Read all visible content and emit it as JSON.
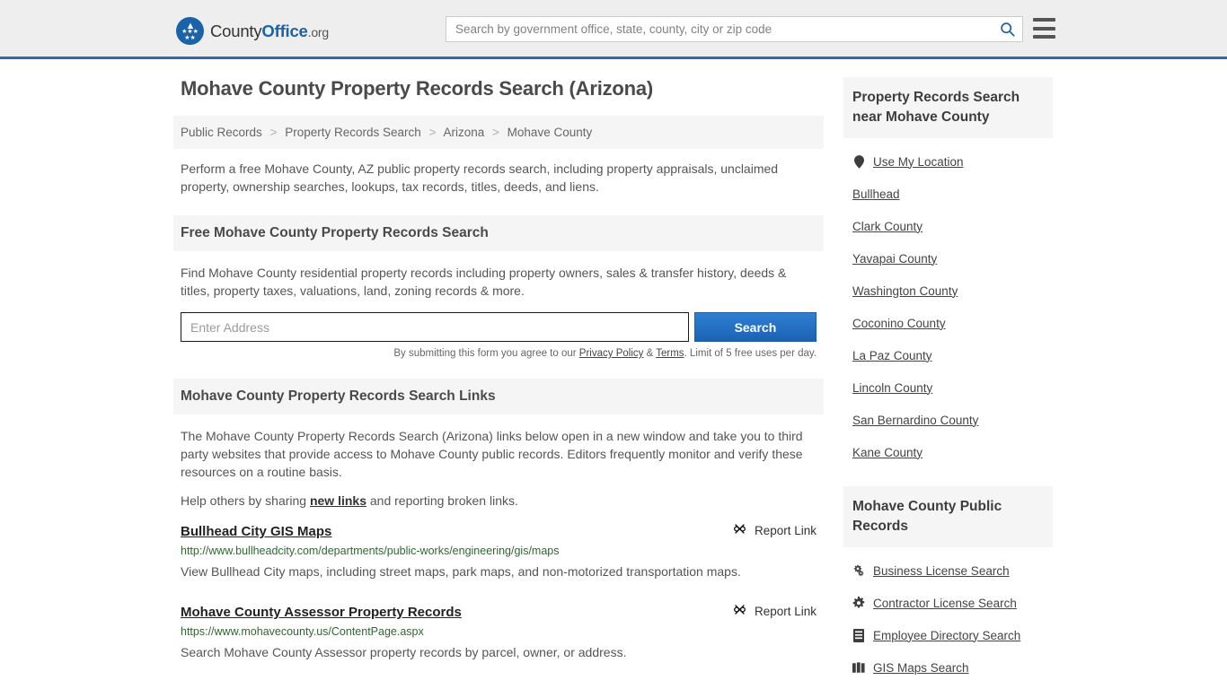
{
  "header": {
    "logo": {
      "prefix": "County",
      "strong": "Office",
      "suffix": ".org",
      "icon": "eagle-seal-icon"
    },
    "search_placeholder": "Search by government office, state, county, city or zip code",
    "search_value": "",
    "search_icon": "search-icon",
    "menu_icon": "hamburger-menu-icon"
  },
  "main": {
    "title": "Mohave County Property Records Search (Arizona)",
    "breadcrumb": [
      {
        "label": "Public Records"
      },
      {
        "label": "Property Records Search"
      },
      {
        "label": "Arizona"
      },
      {
        "label": "Mohave County"
      }
    ],
    "breadcrumb_separator": ">",
    "intro": "Perform a free Mohave County, AZ public property records search, including property appraisals, unclaimed property, ownership searches, lookups, tax records, titles, deeds, and liens.",
    "search_section": {
      "heading": "Free Mohave County Property Records Search",
      "description": "Find Mohave County residential property records including property owners, sales & transfer history, deeds & titles, property taxes, valuations, land, zoning records & more.",
      "input_placeholder": "Enter Address",
      "input_value": "",
      "button_label": "Search",
      "disclaimer_pre": "By submitting this form you agree to our ",
      "privacy_label": "Privacy Policy",
      "disclaimer_amp": " & ",
      "terms_label": "Terms",
      "disclaimer_post": ". Limit of 5 free uses per day."
    },
    "links_section": {
      "heading": "Mohave County Property Records Search Links",
      "paragraph": "The Mohave County Property Records Search (Arizona) links below open in a new window and take you to third party websites that provide access to Mohave County public records. Editors frequently monitor and verify these resources on a routine basis.",
      "help_pre": "Help others by sharing ",
      "help_link": "new links",
      "help_post": " and reporting broken links.",
      "report_label": "Report Link",
      "report_icon": "broken-link-icon",
      "items": [
        {
          "title": "Bullhead City GIS Maps",
          "url": "http://www.bullheadcity.com/departments/public-works/engineering/gis/maps",
          "description": "View Bullhead City maps, including street maps, park maps, and non-motorized transportation maps."
        },
        {
          "title": "Mohave County Assessor Property Records",
          "url": "https://www.mohavecounty.us/ContentPage.aspx",
          "description": "Search Mohave County Assessor property records by parcel, owner, or address."
        }
      ]
    }
  },
  "sidebar": {
    "nearby": {
      "heading": "Property Records Search near Mohave County",
      "items": [
        {
          "label": "Use My Location",
          "icon": "map-pin-icon"
        },
        {
          "label": "Bullhead",
          "icon": ""
        },
        {
          "label": "Clark County",
          "icon": ""
        },
        {
          "label": "Yavapai County",
          "icon": ""
        },
        {
          "label": "Washington County",
          "icon": ""
        },
        {
          "label": "Coconino County",
          "icon": ""
        },
        {
          "label": "La Paz County",
          "icon": ""
        },
        {
          "label": "Lincoln County",
          "icon": ""
        },
        {
          "label": "San Bernardino County",
          "icon": ""
        },
        {
          "label": "Kane County",
          "icon": ""
        }
      ]
    },
    "public_records": {
      "heading": "Mohave County Public Records",
      "items": [
        {
          "label": "Business License Search",
          "icon": "gears-icon"
        },
        {
          "label": "Contractor License Search",
          "icon": "gear-icon"
        },
        {
          "label": "Employee Directory Search",
          "icon": "list-document-icon"
        },
        {
          "label": "GIS Maps Search",
          "icon": "map-book-icon"
        }
      ]
    }
  },
  "colors": {
    "accent_blue": "#1b63a8",
    "header_bg": "#eeeeee",
    "panel_bg": "#f5f5f5",
    "url_green": "#2d6a2d",
    "text_gray": "#555555"
  }
}
